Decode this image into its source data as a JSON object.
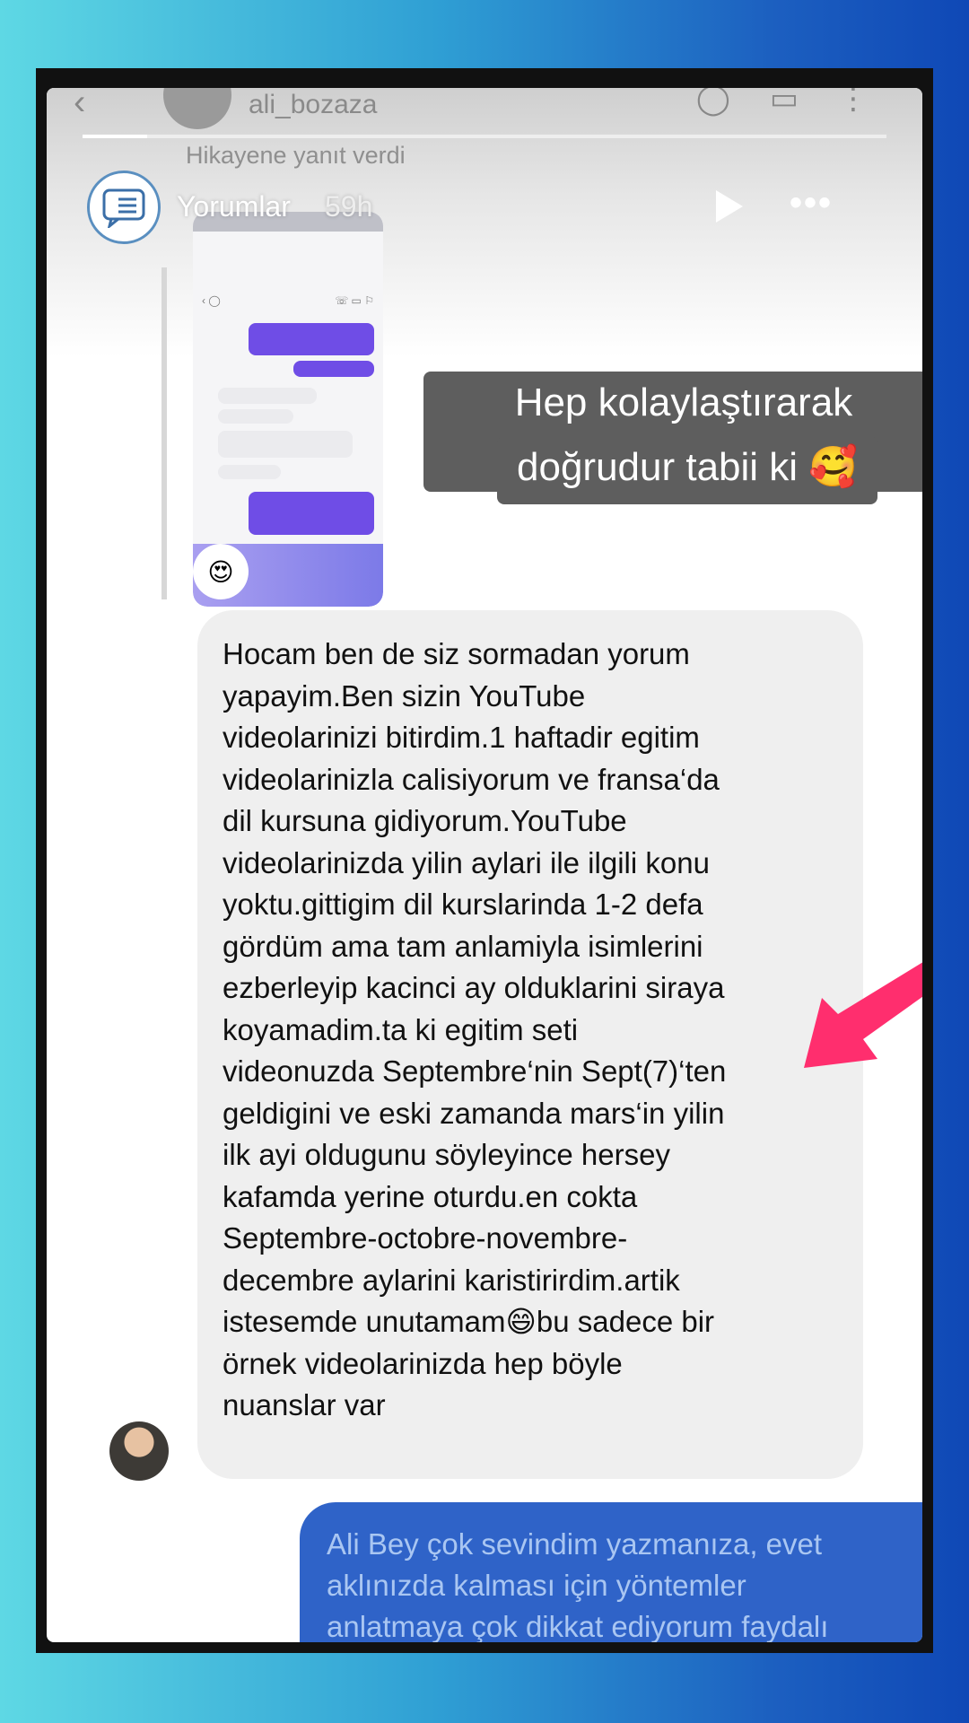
{
  "dm_header": {
    "username": "ali_bozaza"
  },
  "story_reply": {
    "note": "Hikayene yanıt verdi",
    "account_name": "Yorumlar",
    "time_ago": "59h",
    "progress_fraction": 0.08,
    "caption_line1": "Hep kolaylaştırarak anlattığım",
    "caption_line2": "doğrudur tabii ki 🥰",
    "thumbnail_emoji": "😍"
  },
  "comment": {
    "text": "Hocam ben de siz sormadan yorum\nyapayim.Ben sizin YouTube\nvideolarinizi bitirdim.1 haftadir egitim\nvideolarinizla calisiyorum ve fransa‘da\ndil kursuna gidiyorum.YouTube\nvideolarinizda yilin aylari ile ilgili konu\nyoktu.gittigim dil kurslarinda 1-2 defa\ngördüm ama tam anlamiyla isimlerini\nezberleyip kacinci ay olduklarini siraya\nkoyamadim.ta ki egitim seti\nvideonuzda Septembre‘nin Sept(7)‘ten\ngeldigini ve eski zamanda mars‘in yilin\nilk ayi oldugunu söyleyince hersey\nkafamda yerine oturdu.en cokta\nSeptembre-octobre-novembre-\ndecembre aylarini karistirirdim.artik\nistesemde unutamam😄bu sadece bir\nörnek videolarinizda hep böyle\nnuanslar var"
  },
  "reply": {
    "text": "Ali Bey çok sevindim yazmanıza, evet\naklınızda kalması için yöntemler\nanlatmaya çok dikkat ediyorum faydalı\nolmasına çok sevindimm 🙏🥰🌸"
  },
  "colors": {
    "own_bubble": "#2f63c8",
    "arrow": "#ff2e6e",
    "caption_bg": "#5e5e5e"
  }
}
